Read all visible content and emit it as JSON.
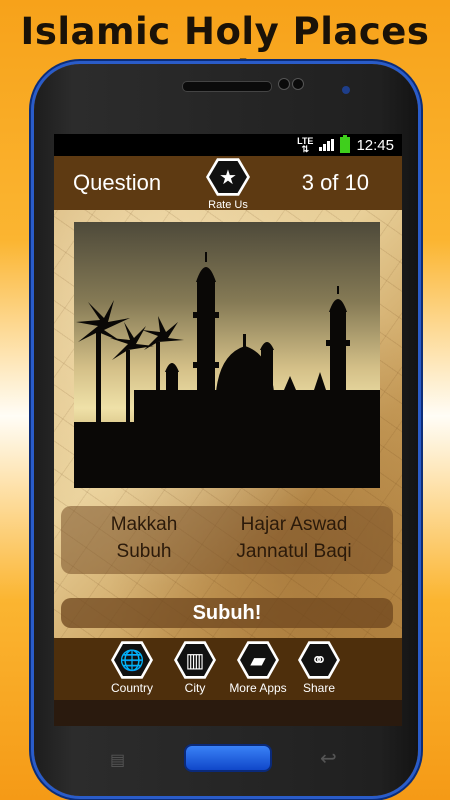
{
  "promo": {
    "title": "Islamic Holy Places Quiz"
  },
  "status_bar": {
    "network": "LTE",
    "time": "12:45"
  },
  "header": {
    "question_label": "Question",
    "progress": "3 of 10",
    "rate_label": "Rate Us",
    "rate_icon": "star-icon"
  },
  "question_image": {
    "icon": "mosque-silhouette"
  },
  "answers": [
    "Makkah",
    "Hajar Aswad",
    "Subuh",
    "Jannatul Baqi"
  ],
  "result": {
    "text": "Subuh!"
  },
  "footer": {
    "buttons": [
      {
        "label": "Country",
        "icon": "globe-icon"
      },
      {
        "label": "City",
        "icon": "city-icon"
      },
      {
        "label": "More Apps",
        "icon": "apps-icon"
      },
      {
        "label": "Share",
        "icon": "share-icon"
      }
    ]
  },
  "colors": {
    "header_bg": "#5e3a12",
    "footer_bg": "#4e2f0c",
    "accent": "#2a5cc9"
  }
}
